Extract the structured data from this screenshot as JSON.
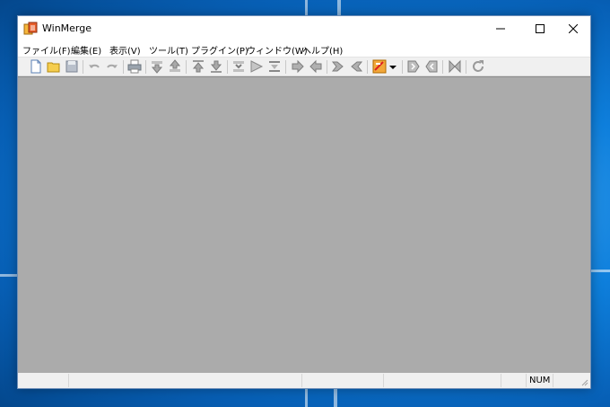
{
  "window": {
    "title": "WinMerge"
  },
  "title_buttons": {
    "minimize": "minimize-icon",
    "maximize": "maximize-icon",
    "close": "close-icon"
  },
  "menu": [
    "ファイル(F)",
    "編集(E)",
    "表示(V)",
    "ツール(T)",
    "プラグイン(P)",
    "ウィンドウ(W)",
    "ヘルプ(H)"
  ],
  "toolbar_icons": [
    "new-icon",
    "open-icon",
    "save-icon",
    "undo-icon",
    "redo-icon",
    "print-icon",
    "next-diff-icon",
    "prev-diff-icon",
    "first-diff-icon",
    "last-diff-icon",
    "current-diff-icon",
    "next-conflict-icon",
    "prev-conflict-icon",
    "copy-right-icon",
    "copy-left-icon",
    "copy-right-advance-icon",
    "copy-left-advance-icon",
    "options-icon",
    "dropdown-arrow-icon",
    "next-file-icon",
    "prev-file-icon",
    "compare-icon",
    "refresh-icon"
  ],
  "status": {
    "num": "NUM"
  },
  "colors": {
    "content_bg": "#ababab",
    "desktop": "#0a78d4"
  }
}
